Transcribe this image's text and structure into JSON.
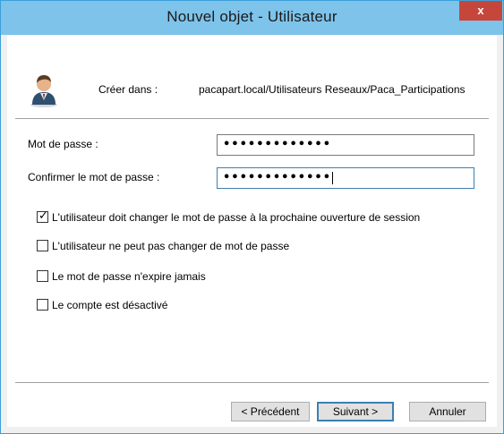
{
  "window": {
    "title": "Nouvel objet - Utilisateur",
    "close_glyph": "x"
  },
  "header": {
    "icon": "user-icon",
    "create_label": "Créer dans :",
    "create_path": "pacapart.local/Utilisateurs Reseaux/Paca_Participations"
  },
  "form": {
    "password_label": "Mot de passe :",
    "password_value": "•••••••••••••",
    "confirm_label": "Confirmer le mot de passe :",
    "confirm_value": "•••••••••••••"
  },
  "options": [
    {
      "label": "L'utilisateur doit changer le mot de passe à la prochaine ouverture de session",
      "checked": true
    },
    {
      "label": "L'utilisateur ne peut pas changer de mot de passe",
      "checked": false
    },
    {
      "label": "Le mot de passe n'expire jamais",
      "checked": false
    },
    {
      "label": "Le compte est désactivé",
      "checked": false
    }
  ],
  "buttons": {
    "back": "< Précédent",
    "next": "Suivant >",
    "cancel": "Annuler"
  },
  "colors": {
    "titlebar": "#7ec3ea",
    "close": "#c7463c",
    "focus": "#3c7fb1"
  }
}
